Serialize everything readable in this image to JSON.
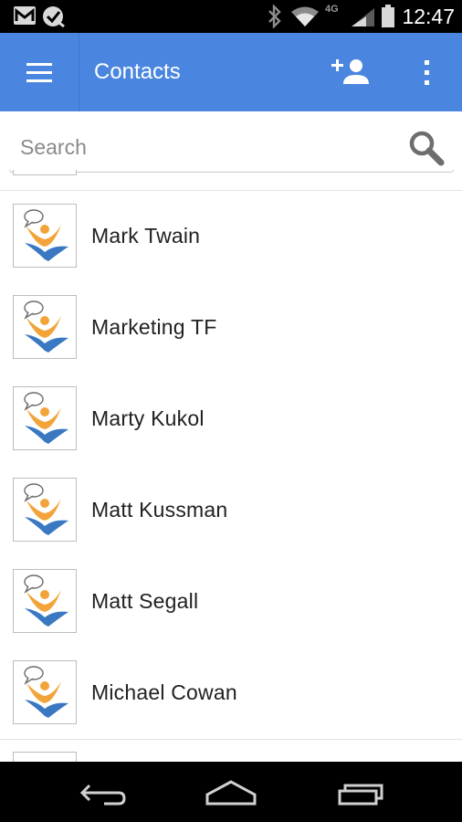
{
  "status_bar": {
    "time": "12:47",
    "network": "4G",
    "left_icons": [
      "gmail-notification-icon",
      "check-circle-icon"
    ],
    "right_icons": [
      "bluetooth-icon",
      "wifi-icon",
      "cell-signal-icon",
      "battery-icon"
    ]
  },
  "app_bar": {
    "title": "Contacts",
    "color": "#4a86e0",
    "menu_icon": "hamburger-menu-icon",
    "add_contact_icon": "add-person-icon",
    "overflow_icon": "more-vert-icon"
  },
  "search": {
    "placeholder": "Search",
    "value": "",
    "icon": "search-icon"
  },
  "contacts": [
    {
      "name": "Mark Twain",
      "avatar": "default-contact-avatar"
    },
    {
      "name": "Marketing TF",
      "avatar": "default-contact-avatar"
    },
    {
      "name": "Marty Kukol",
      "avatar": "default-contact-avatar"
    },
    {
      "name": "Matt Kussman",
      "avatar": "default-contact-avatar"
    },
    {
      "name": "Matt Segall",
      "avatar": "default-contact-avatar"
    },
    {
      "name": "Michael Cowan",
      "avatar": "default-contact-avatar"
    }
  ],
  "nav_bar": {
    "buttons": [
      "back-icon",
      "home-icon",
      "recent-apps-icon"
    ]
  }
}
